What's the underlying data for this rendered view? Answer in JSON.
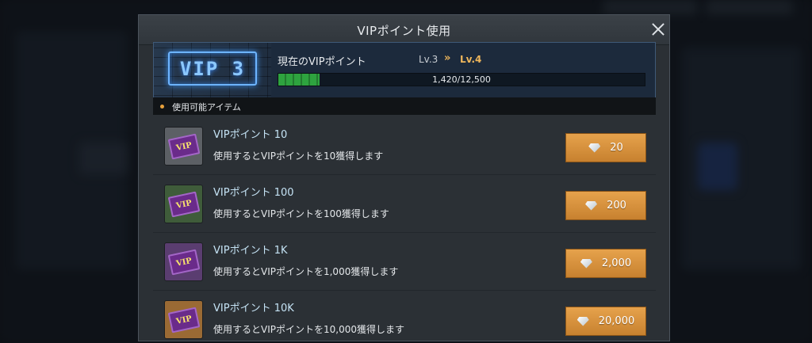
{
  "dialog": {
    "title": "VIPポイント使用",
    "badge": "VIP 3",
    "points_label": "現在のVIPポイント",
    "level_current": "Lv.3",
    "level_arrow": "»",
    "level_next": "Lv.4",
    "progress_text": "1,420/12,500",
    "progress_fraction": 0.1136,
    "section_title": "使用可能アイテム"
  },
  "items": [
    {
      "name": "VIPポイント 10",
      "desc": "使用するとVIPポイントを10獲得します",
      "price": "20",
      "icon_bg": "#5c6065",
      "ticket_text": "VIP"
    },
    {
      "name": "VIPポイント 100",
      "desc": "使用するとVIPポイントを100獲得します",
      "price": "200",
      "icon_bg": "#3f5c3a",
      "ticket_text": "VIP"
    },
    {
      "name": "VIPポイント 1K",
      "desc": "使用するとVIPポイントを1,000獲得します",
      "price": "2,000",
      "icon_bg": "#5a3d70",
      "ticket_text": "VIP"
    },
    {
      "name": "VIPポイント 10K",
      "desc": "使用するとVIPポイントを10,000獲得します",
      "price": "20,000",
      "icon_bg": "#9a6a34",
      "ticket_text": "VIP"
    }
  ],
  "icons": {
    "close": "close-icon",
    "gem": "diamond-icon",
    "dot": "bullet-icon"
  },
  "colors": {
    "accent_orange": "#e6a24c",
    "progress_green": "#2ea33f",
    "level_next": "#eeb65b"
  }
}
